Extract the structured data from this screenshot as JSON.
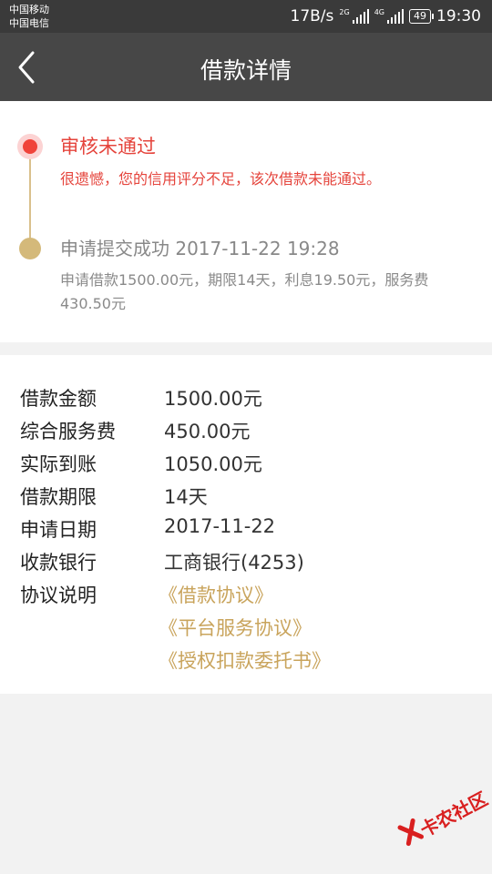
{
  "statusbar": {
    "carrier1": "中国移动",
    "carrier2": "中国电信",
    "speed": "17B/s",
    "net1": "2G",
    "net2": "4G",
    "battery": "49",
    "time": "19:30"
  },
  "navbar": {
    "title": "借款详情",
    "back_icon": "chevron-left-icon"
  },
  "timeline": {
    "rejected_title": "审核未通过",
    "rejected_desc": "很遗憾，您的信用评分不足，该次借款未能通过。",
    "submitted_title": "申请提交成功 2017-11-22 19:28",
    "submitted_desc": "申请借款1500.00元，期限14天，利息19.50元，服务费430.50元",
    "colors": {
      "reject": "#e5443c",
      "gold": "#d4b97a"
    }
  },
  "details": {
    "rows": [
      {
        "label": "借款金额",
        "value": "1500.00元"
      },
      {
        "label": "综合服务费",
        "value": "450.00元"
      },
      {
        "label": "实际到账",
        "value": "1050.00元"
      },
      {
        "label": "借款期限",
        "value": "14天"
      },
      {
        "label": "申请日期",
        "value": "2017-11-22"
      },
      {
        "label": "收款银行",
        "value": "工商银行(4253)"
      },
      {
        "label": "协议说明",
        "value": ""
      }
    ],
    "links": [
      "《借款协议》",
      "《平台服务协议》",
      "《授权扣款委托书》"
    ],
    "link_color": "#c9a45c"
  },
  "watermark": {
    "text": "卡农社区"
  }
}
